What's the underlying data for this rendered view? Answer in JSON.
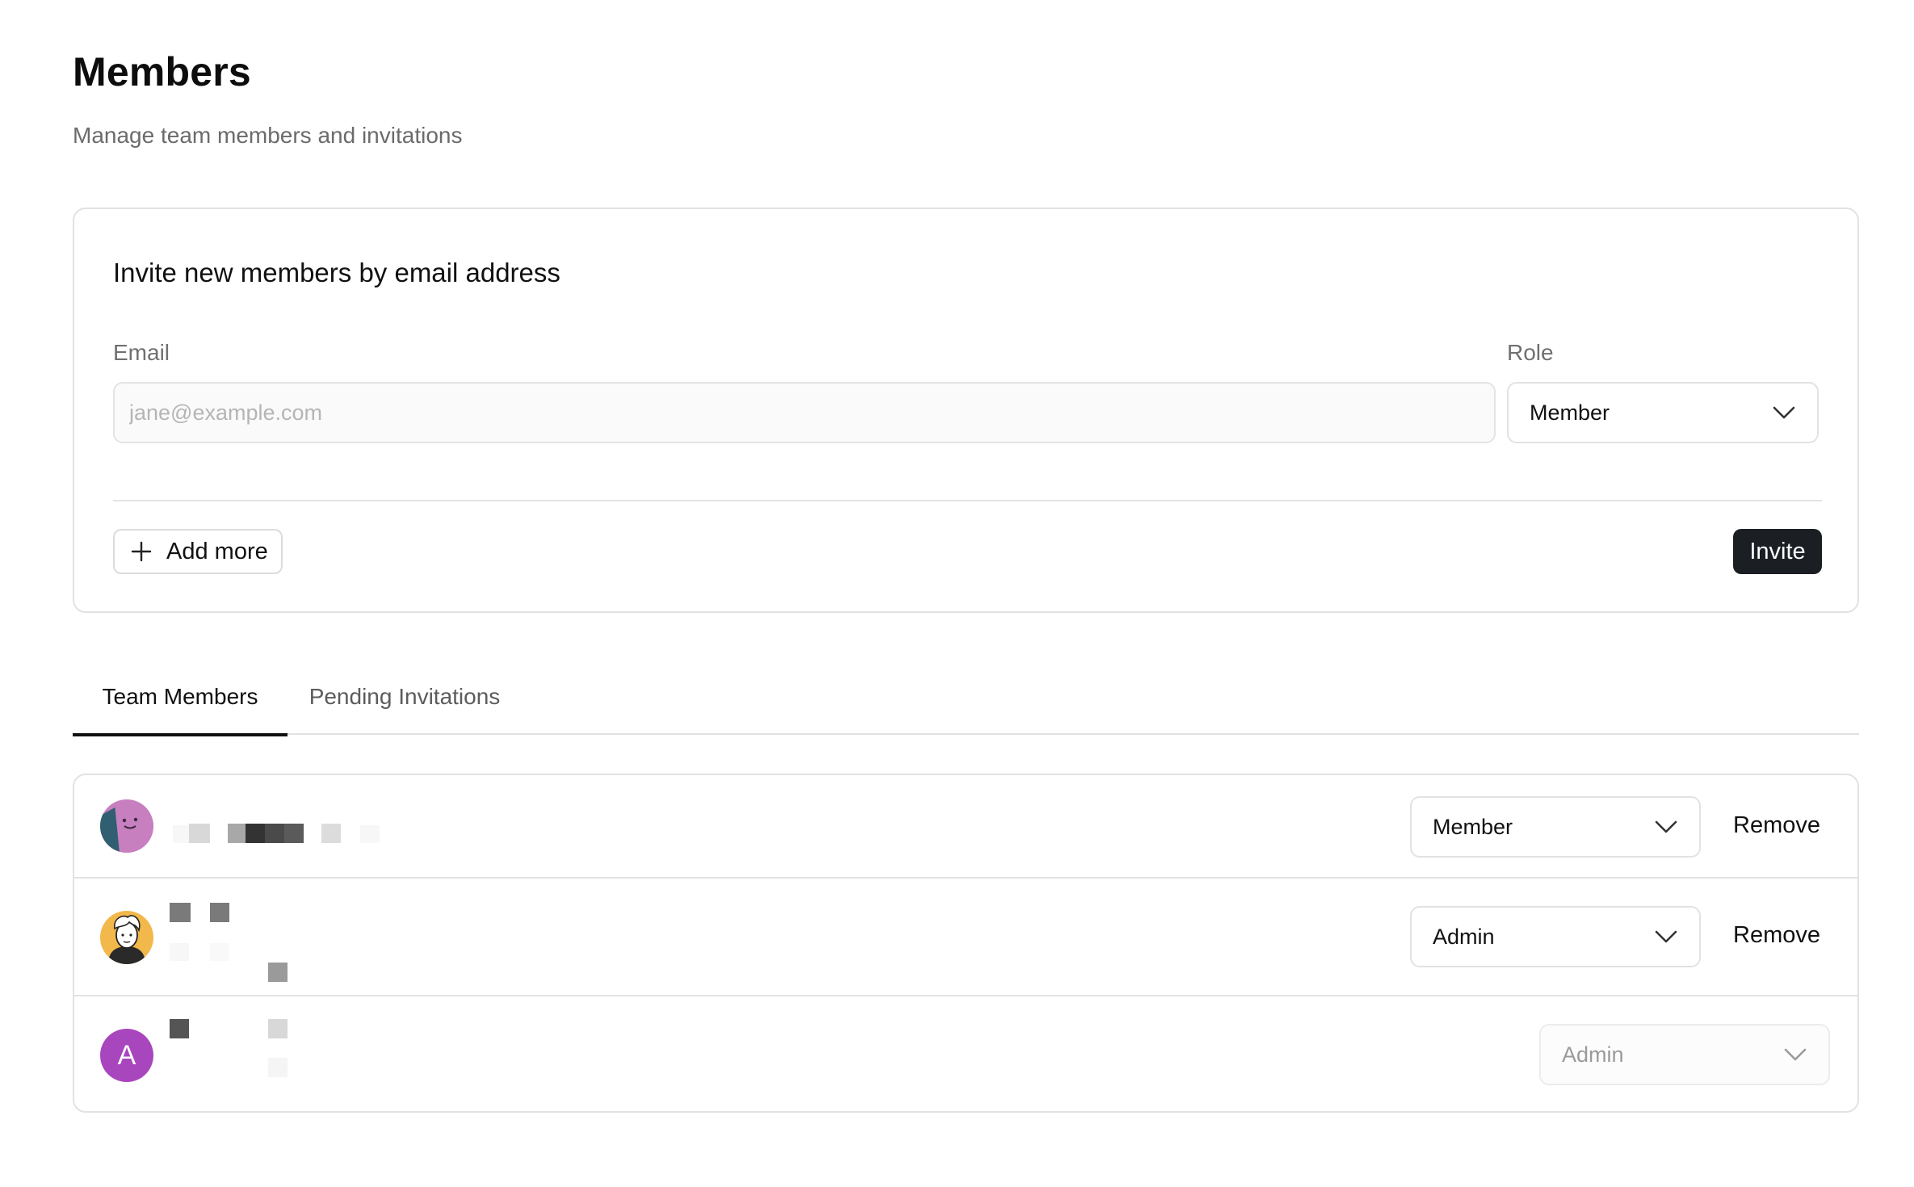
{
  "header": {
    "title": "Members",
    "subtitle": "Manage team members and invitations"
  },
  "invite": {
    "title": "Invite new members by email address",
    "email_label": "Email",
    "email_placeholder": "jane@example.com",
    "email_value": "",
    "role_label": "Role",
    "role_value": "Member",
    "add_more_label": "Add more",
    "invite_label": "Invite"
  },
  "tabs": [
    {
      "label": "Team Members",
      "active": true
    },
    {
      "label": "Pending Invitations",
      "active": false
    }
  ],
  "members": [
    {
      "avatar": "purple-face-avatar",
      "role": "Member",
      "remove_label": "Remove",
      "role_editable": true
    },
    {
      "avatar": "illustrated-person-avatar",
      "role": "Admin",
      "remove_label": "Remove",
      "role_editable": true
    },
    {
      "avatar_letter": "A",
      "role": "Admin",
      "role_editable": false
    }
  ],
  "colors": {
    "primary_button": "#1b1f24",
    "border": "#e2e2e2",
    "muted_text": "#6b6b6b",
    "avatar_letter_bg": "#a846be"
  },
  "icons": {
    "dropdown": "chevron-down-icon",
    "add": "plus-icon"
  }
}
